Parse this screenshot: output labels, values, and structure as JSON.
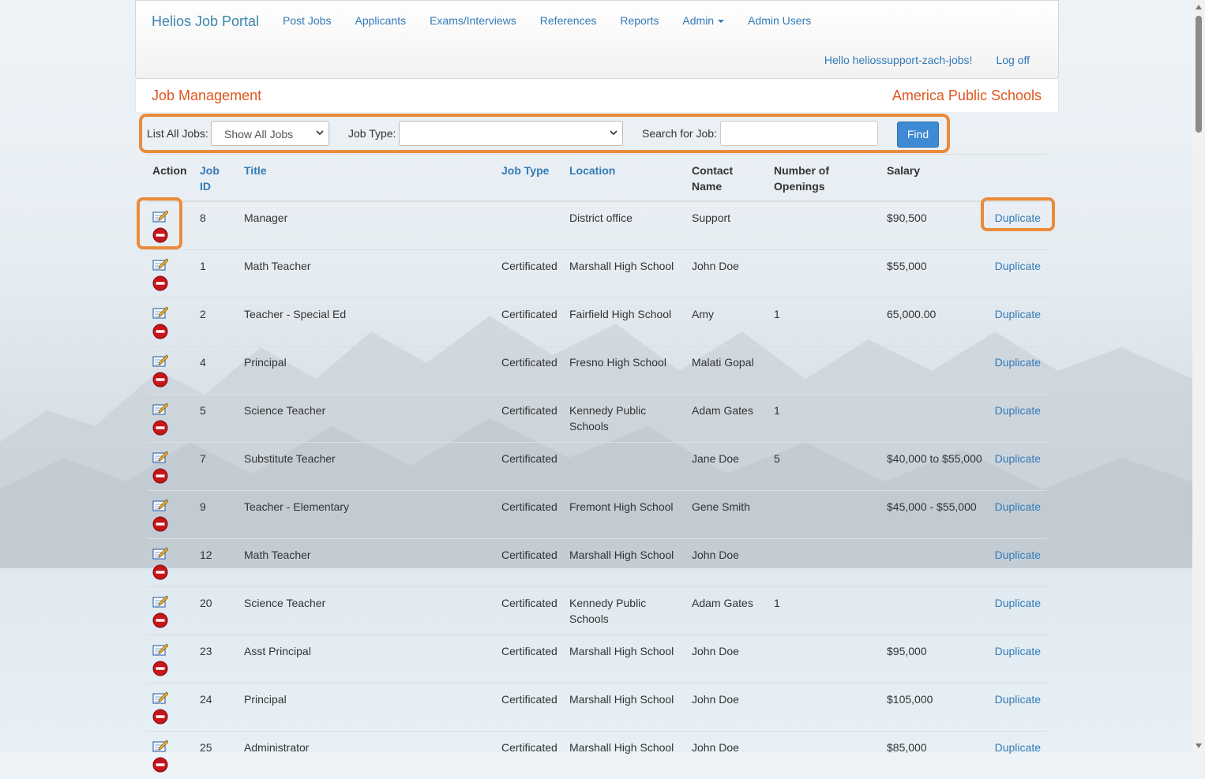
{
  "navbar": {
    "brand": "Helios Job Portal",
    "items": [
      "Post Jobs",
      "Applicants",
      "Exams/Interviews",
      "References",
      "Reports",
      "Admin",
      "Admin Users"
    ],
    "greeting": "Hello heliossupport-zach-jobs!",
    "logoff": "Log off"
  },
  "titlebar": {
    "left": "Job Management",
    "right": "America Public Schools"
  },
  "filter": {
    "list_label": "List All Jobs:",
    "list_value": "Show All Jobs",
    "type_label": "Job Type:",
    "type_value": "",
    "search_label": "Search for Job:",
    "search_value": "",
    "find_label": "Find"
  },
  "table": {
    "headers": {
      "action": "Action",
      "job_id": "Job ID",
      "title": "Title",
      "job_type": "Job Type",
      "location": "Location",
      "contact": "Contact Name",
      "openings": "Number of Openings",
      "salary": "Salary"
    },
    "rows": [
      {
        "id": "8",
        "title": "Manager",
        "type": "",
        "location": "District office",
        "contact": "Support",
        "openings": "",
        "salary": "$90,500",
        "action": "Duplicate"
      },
      {
        "id": "1",
        "title": "Math Teacher",
        "type": "Certificated",
        "location": "Marshall High School",
        "contact": "John Doe",
        "openings": "",
        "salary": "$55,000",
        "action": "Duplicate"
      },
      {
        "id": "2",
        "title": "Teacher - Special Ed",
        "type": "Certificated",
        "location": "Fairfield High School",
        "contact": "Amy",
        "openings": "1",
        "salary": "65,000.00",
        "action": "Duplicate"
      },
      {
        "id": "4",
        "title": "Principal",
        "type": "Certificated",
        "location": "Fresno High School",
        "contact": "Malati Gopal",
        "openings": "",
        "salary": "",
        "action": "Duplicate"
      },
      {
        "id": "5",
        "title": "Science Teacher",
        "type": "Certificated",
        "location": "Kennedy Public Schools",
        "contact": "Adam Gates",
        "openings": "1",
        "salary": "",
        "action": "Duplicate"
      },
      {
        "id": "7",
        "title": "Substitute Teacher",
        "type": "Certificated",
        "location": "",
        "contact": "Jane Doe",
        "openings": "5",
        "salary": "$40,000 to $55,000",
        "action": "Duplicate"
      },
      {
        "id": "9",
        "title": "Teacher - Elementary",
        "type": "Certificated",
        "location": "Fremont High School",
        "contact": "Gene Smith",
        "openings": "",
        "salary": "$45,000 - $55,000",
        "action": "Duplicate"
      },
      {
        "id": "12",
        "title": "Math Teacher",
        "type": "Certificated",
        "location": "Marshall High School",
        "contact": "John Doe",
        "openings": "",
        "salary": "",
        "action": "Duplicate"
      },
      {
        "id": "20",
        "title": "Science Teacher",
        "type": "Certificated",
        "location": "Kennedy Public Schools",
        "contact": "Adam Gates",
        "openings": "1",
        "salary": "",
        "action": "Duplicate"
      },
      {
        "id": "23",
        "title": "Asst Principal",
        "type": "Certificated",
        "location": "Marshall High School",
        "contact": "John Doe",
        "openings": "",
        "salary": "$95,000",
        "action": "Duplicate"
      },
      {
        "id": "24",
        "title": "Principal",
        "type": "Certificated",
        "location": "Marshall High School",
        "contact": "John Doe",
        "openings": "",
        "salary": "$105,000",
        "action": "Duplicate"
      },
      {
        "id": "25",
        "title": "Administrator",
        "type": "Certificated",
        "location": "Marshall High School",
        "contact": "John Doe",
        "openings": "",
        "salary": "$85,000",
        "action": "Duplicate"
      }
    ]
  },
  "colors": {
    "accent_orange": "#e0561f",
    "highlight_orange": "#ea8b3a",
    "link_blue": "#337ab7",
    "button_blue": "#3e8ad5"
  },
  "icons": {
    "edit": "edit-icon",
    "delete": "delete-icon",
    "dropdown": "chevron-down-icon"
  }
}
